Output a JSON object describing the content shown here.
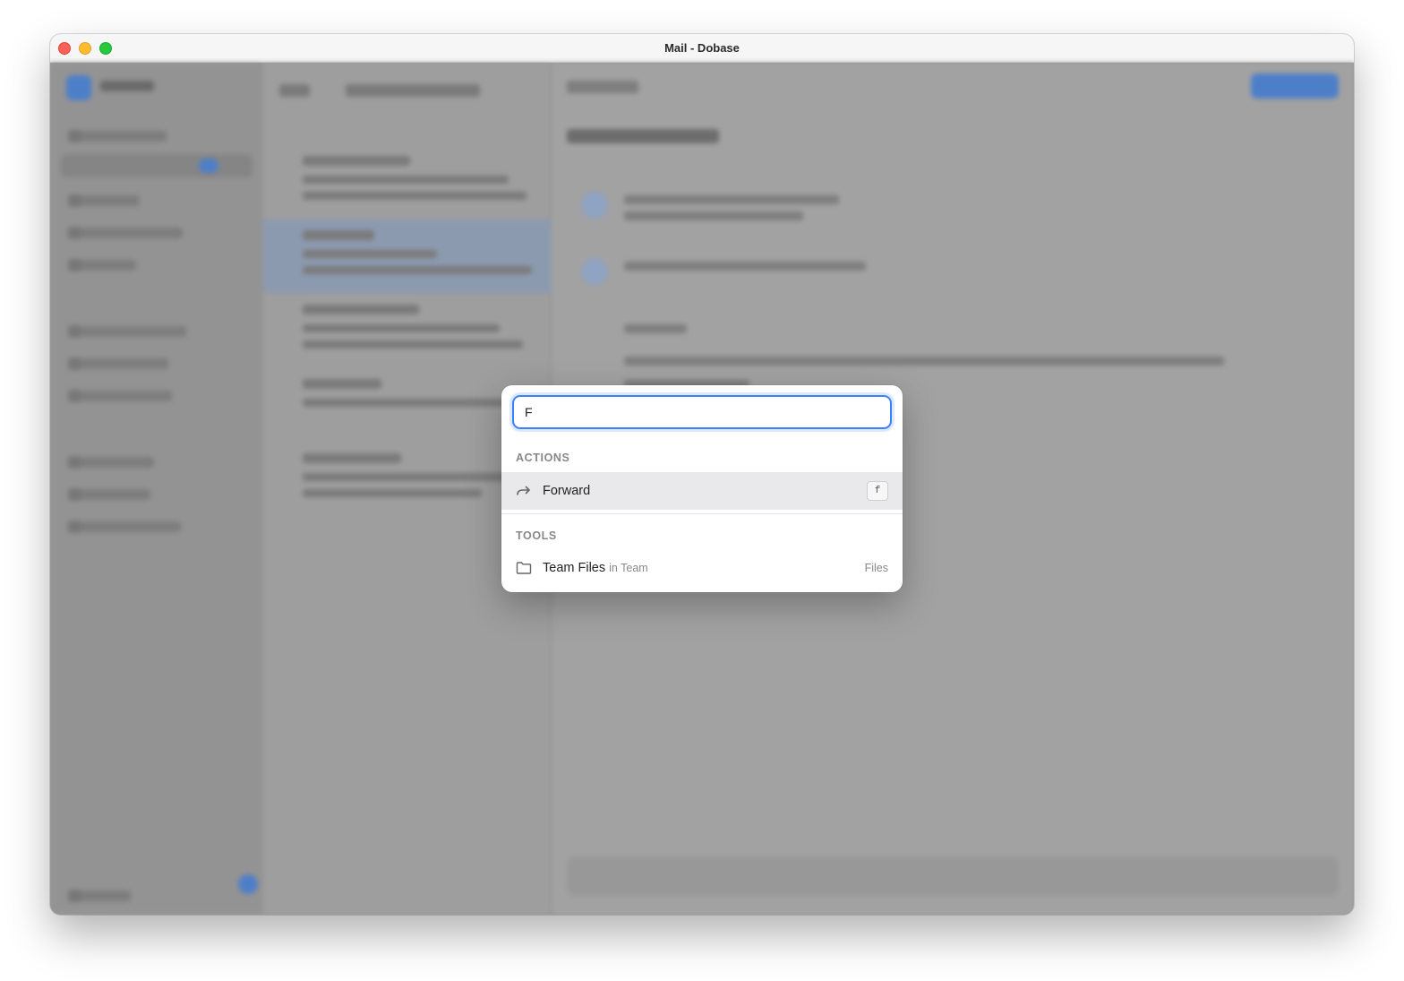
{
  "window": {
    "title": "Mail - Dobase"
  },
  "palette": {
    "search": {
      "value": "F",
      "placeholder": ""
    },
    "sections": {
      "actions": {
        "label": "ACTIONS",
        "items": [
          {
            "label": "Forward",
            "shortcut": "f",
            "icon": "forward-arrow-icon"
          }
        ]
      },
      "tools": {
        "label": "TOOLS",
        "items": [
          {
            "label": "Team Files",
            "context": "in Team",
            "hint": "Files",
            "icon": "folder-icon"
          }
        ]
      }
    }
  },
  "colors": {
    "accent": "#3b82f6",
    "active_row": "#e9e9ec",
    "close": "#fe5f57",
    "minimize": "#febc2e",
    "maximize": "#28c840"
  }
}
